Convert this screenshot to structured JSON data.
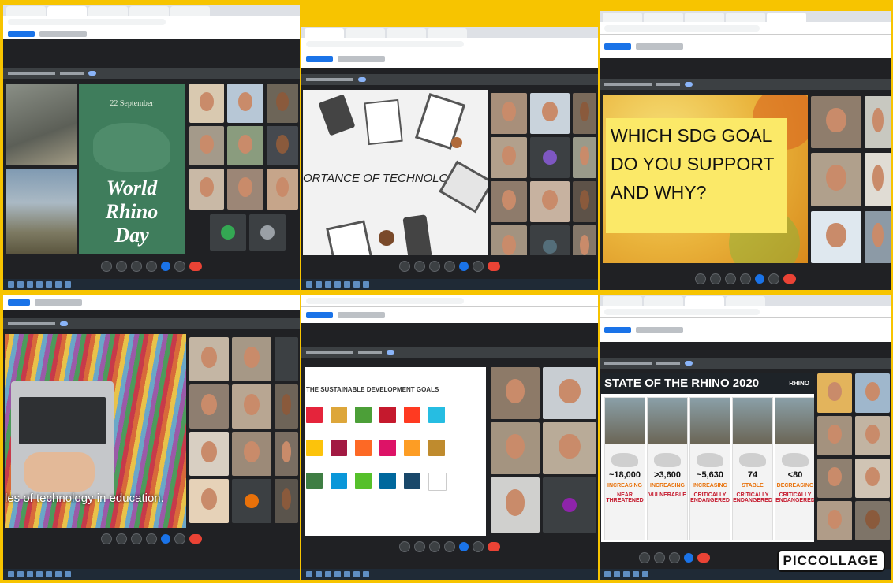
{
  "panel1": {
    "date": "22 September",
    "title_line1": "World",
    "title_line2": "Rhino",
    "title_line3": "Day"
  },
  "panel2": {
    "slide_text": "ORTANCE OF TECHNOLOGY"
  },
  "panel3": {
    "question": "WHICH SDG GOAL DO YOU SUPPORT AND WHY?"
  },
  "panel4": {
    "caption": "les of technology in education."
  },
  "panel5": {
    "slide_title": "THE SUSTAINABLE DEVELOPMENT GOALS"
  },
  "panel6": {
    "title": "STATE OF THE RHINO 2020",
    "logo": "RHINO",
    "cards": [
      {
        "count": "~18,000",
        "trend": "INCREASING",
        "status": "NEAR THREATENED"
      },
      {
        "count": ">3,600",
        "trend": "INCREASING",
        "status": "VULNERABLE"
      },
      {
        "count": "~5,630",
        "trend": "INCREASING",
        "status": "CRITICALLY ENDANGERED"
      },
      {
        "count": "74",
        "trend": "STABLE",
        "status": "CRITICALLY ENDANGERED"
      },
      {
        "count": "<80",
        "trend": "DECREASING",
        "status": "CRITICALLY ENDANGERED"
      }
    ]
  },
  "watermark": "PICCOLLAGE",
  "colors": {
    "frame": "#f7c400",
    "meet_dark": "#202124",
    "end_call": "#ea4335",
    "accent": "#1a73e8"
  }
}
